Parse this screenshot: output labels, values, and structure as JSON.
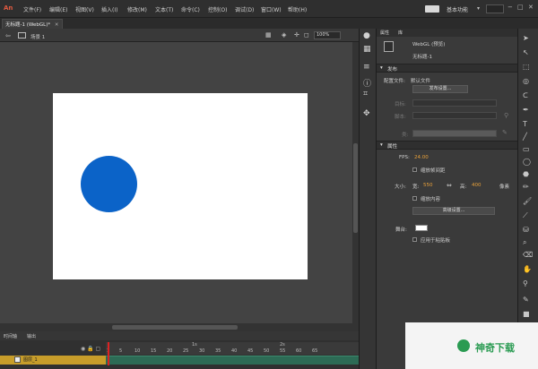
{
  "app": {
    "logo": "An"
  },
  "menu": [
    "文件(F)",
    "编辑(E)",
    "视图(V)",
    "插入(I)",
    "修改(M)",
    "文本(T)",
    "命令(C)",
    "控制(O)",
    "调试(D)",
    "窗口(W)",
    "帮助(H)"
  ],
  "workspace": {
    "label": "基本功能",
    "arrow": "▾"
  },
  "window_controls": {
    "minimize": "−",
    "maximize": "□",
    "close": "✕"
  },
  "document_tab": {
    "title": "无标题-1 (WebGL)*",
    "close": "✕"
  },
  "stage_toolbar": {
    "scene": "场景 1",
    "zoom": "100%"
  },
  "timeline": {
    "tabs": [
      "时间轴",
      "输出"
    ],
    "frame_numbers": [
      "1",
      "5",
      "10",
      "15",
      "20",
      "25",
      "30",
      "35",
      "40",
      "45",
      "50",
      "55",
      "60",
      "65"
    ],
    "seconds": [
      "1s",
      "2s"
    ],
    "layer_name": "图层_1"
  },
  "panel": {
    "tabs": [
      "属性",
      "库"
    ],
    "doc_type": "WebGL (预览)",
    "doc_name": "无标题-1",
    "publish": {
      "header": "发布",
      "profile_label": "配置文件:",
      "profile_value": "默认文件",
      "settings_button": "发布设置...",
      "target_label": "目标:",
      "script_label": "脚本:",
      "class_label": "类:"
    },
    "properties": {
      "header": "属性",
      "fps_label": "FPS:",
      "fps_value": "24.00",
      "scale_span_label": "缩放帧间距",
      "size_label": "大小:",
      "width_label": "宽:",
      "width_value": "550",
      "height_label": "高:",
      "height_value": "400",
      "unit": "像素",
      "scale_content_label": "缩放内容",
      "advanced_button": "高级设置...",
      "stage_label": "舞台:",
      "apply_pasteboard_label": "应用于粘贴板",
      "stage_color": "#ffffff"
    }
  },
  "watermark": {
    "text": "神奇下载"
  },
  "colors": {
    "circle": "#0b63c8",
    "accent": "#e8a13a",
    "layer": "#c79d2a"
  }
}
